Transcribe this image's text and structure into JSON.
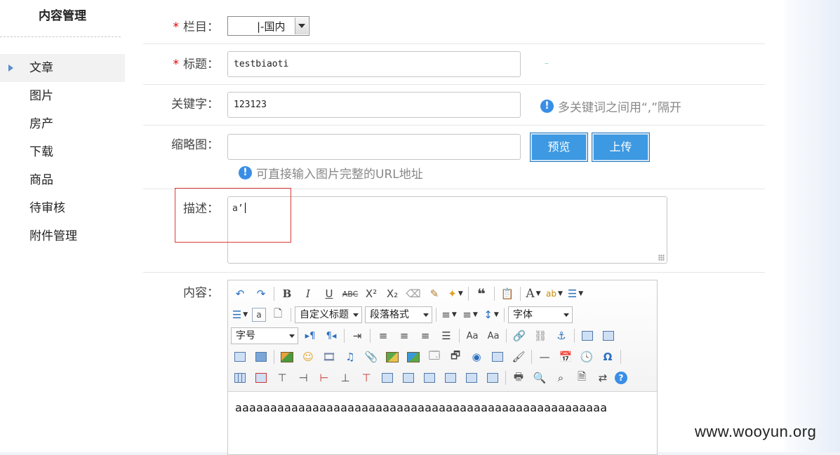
{
  "sidebar": {
    "title": "内容管理",
    "items": [
      {
        "label": "文章"
      },
      {
        "label": "图片"
      },
      {
        "label": "房产"
      },
      {
        "label": "下载"
      },
      {
        "label": "商品"
      },
      {
        "label": "待审核"
      },
      {
        "label": "附件管理"
      }
    ]
  },
  "form": {
    "column": {
      "label": "栏目：",
      "required_mark": "*",
      "value": "|-国内"
    },
    "title": {
      "label": "标题：",
      "required_mark": "*",
      "value": "testbiaoti",
      "dash": "–"
    },
    "keywords": {
      "label": "关键字：",
      "value": "123123",
      "hint": "多关键词之间用“,”隔开"
    },
    "thumbnail": {
      "label": "缩略图：",
      "value": "",
      "preview_button": "预览",
      "upload_button": "上传",
      "hint": "可直接输入图片完整的URL地址"
    },
    "description": {
      "label": "描述：",
      "value": "a’"
    },
    "content": {
      "label": "内容：",
      "toolbar": {
        "custom_heading": "自定义标题",
        "paragraph_format": "段落格式",
        "font_family": "字体",
        "font_size": "字号"
      },
      "body": "aaaaaaaaaaaaaaaaaaaaaaaaaaaaaaaaaaaaaaaaaaaaaaaaaaaaa"
    }
  },
  "watermark": "www.wooyun.org",
  "colors": {
    "accent": "#3d99e2",
    "required": "#e60000",
    "highlight_box": "#d93b3b",
    "info": "#3a8ee6"
  },
  "icons": [
    "undo-icon",
    "redo-icon",
    "bold-icon",
    "italic-icon",
    "underline-icon",
    "strikethrough-icon",
    "superscript-icon",
    "subscript-icon",
    "eraser-icon",
    "format-brush-icon",
    "magic-wand-icon",
    "blockquote-icon",
    "paste-plain-icon",
    "font-color-icon",
    "highlight-icon",
    "ordered-list-icon",
    "unordered-list-icon",
    "info-icon"
  ]
}
